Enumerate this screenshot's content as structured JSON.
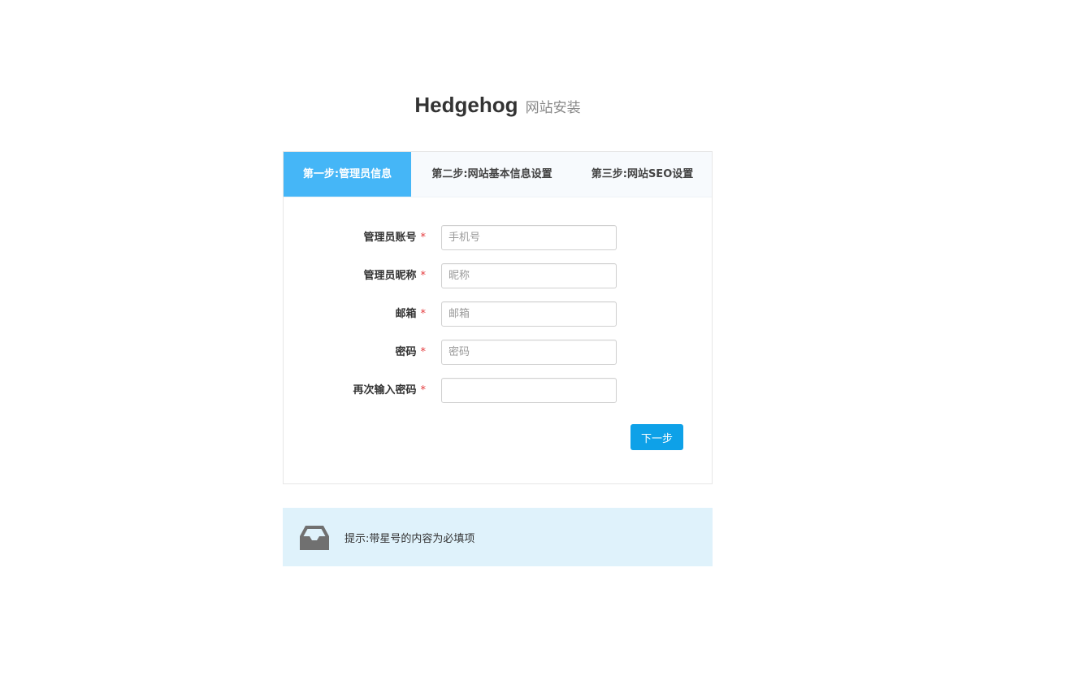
{
  "header": {
    "brand": "Hedgehog",
    "subtitle": "网站安装"
  },
  "steps": [
    {
      "label": "第一步:管理员信息",
      "active": true
    },
    {
      "label": "第二步:网站基本信息设置",
      "active": false
    },
    {
      "label": "第三步:网站SEO设置",
      "active": false
    }
  ],
  "form": {
    "fields": [
      {
        "label": "管理员账号",
        "required": "*",
        "placeholder": "手机号",
        "value": ""
      },
      {
        "label": "管理员昵称",
        "required": "*",
        "placeholder": "昵称",
        "value": ""
      },
      {
        "label": "邮箱",
        "required": "*",
        "placeholder": "邮箱",
        "value": ""
      },
      {
        "label": "密码",
        "required": "*",
        "placeholder": "密码",
        "value": ""
      },
      {
        "label": "再次输入密码",
        "required": "*",
        "placeholder": "",
        "value": ""
      }
    ],
    "next_label": "下一步"
  },
  "notice": {
    "icon": "inbox-icon",
    "text": "提示:带星号的内容为必填项"
  },
  "colors": {
    "active_tab": "#45b6f7",
    "button": "#0ea1e8",
    "notice_bg": "#dff2fb",
    "required_star": "#e4393c"
  }
}
